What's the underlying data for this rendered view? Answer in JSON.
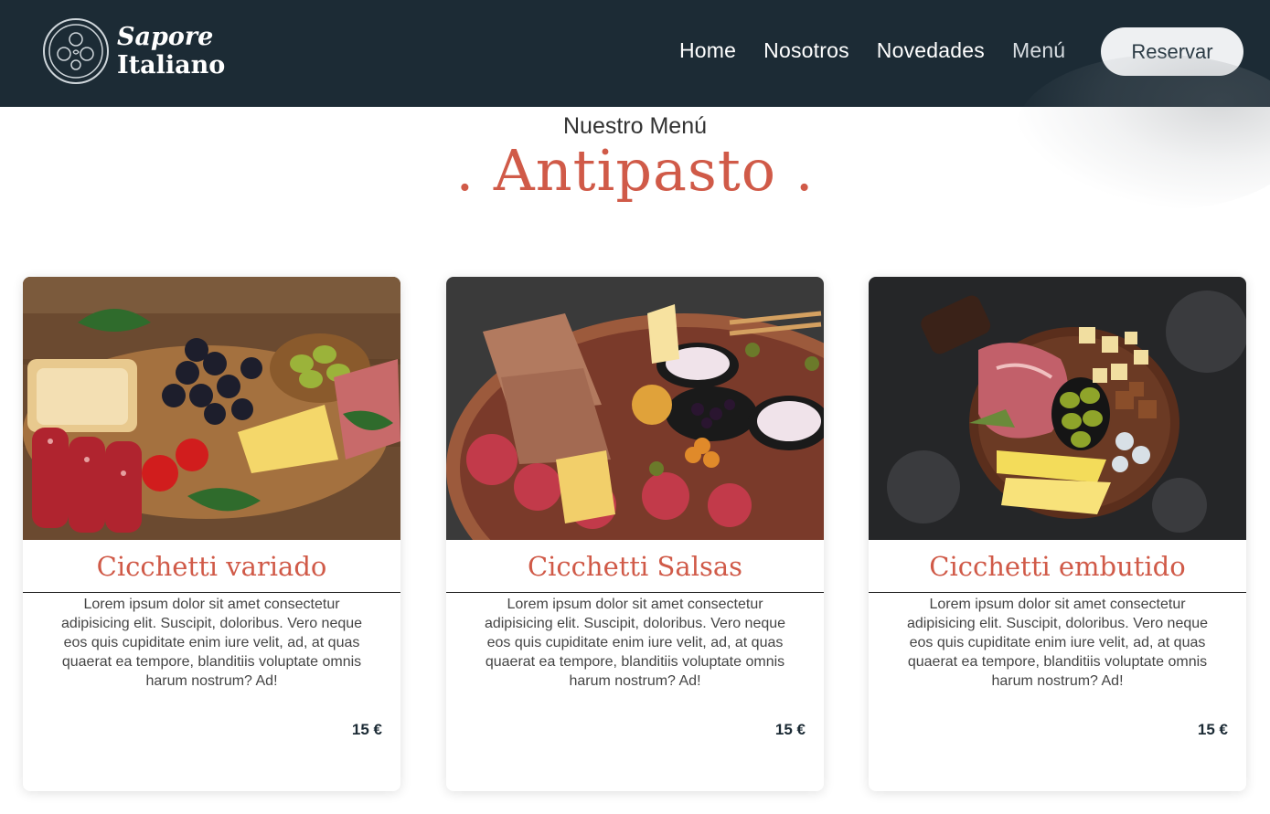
{
  "brand": {
    "line1": "Sapore",
    "line2": "Italiano",
    "icon": "pizza-plate-icon"
  },
  "nav": {
    "items": [
      {
        "label": "Home"
      },
      {
        "label": "Nosotros"
      },
      {
        "label": "Novedades"
      },
      {
        "label": "Menú"
      }
    ],
    "reserve_label": "Reservar"
  },
  "section": {
    "subtitle": "Nuestro Menú",
    "title": ". Antipasto ."
  },
  "cards": [
    {
      "title": "Cicchetti variado",
      "description": "Lorem ipsum dolor sit amet consectetur adipisicing elit. Suscipit, doloribus. Vero neque eos quis cupiditate enim iure velit, ad, at quas quaerat ea tempore, blanditiis voluptate omnis harum nostrum? Ad!",
      "price": "15 €"
    },
    {
      "title": "Cicchetti Salsas",
      "description": "Lorem ipsum dolor sit amet consectetur adipisicing elit. Suscipit, doloribus. Vero neque eos quis cupiditate enim iure velit, ad, at quas quaerat ea tempore, blanditiis voluptate omnis harum nostrum? Ad!",
      "price": "15 €"
    },
    {
      "title": "Cicchetti embutido",
      "description": "Lorem ipsum dolor sit amet consectetur adipisicing elit. Suscipit, doloribus. Vero neque eos quis cupiditate enim iure velit, ad, at quas quaerat ea tempore, blanditiis voluptate omnis harum nostrum? Ad!",
      "price": "15 €"
    }
  ],
  "colors": {
    "header_bg": "#1c2b35",
    "accent": "#d05a48"
  }
}
